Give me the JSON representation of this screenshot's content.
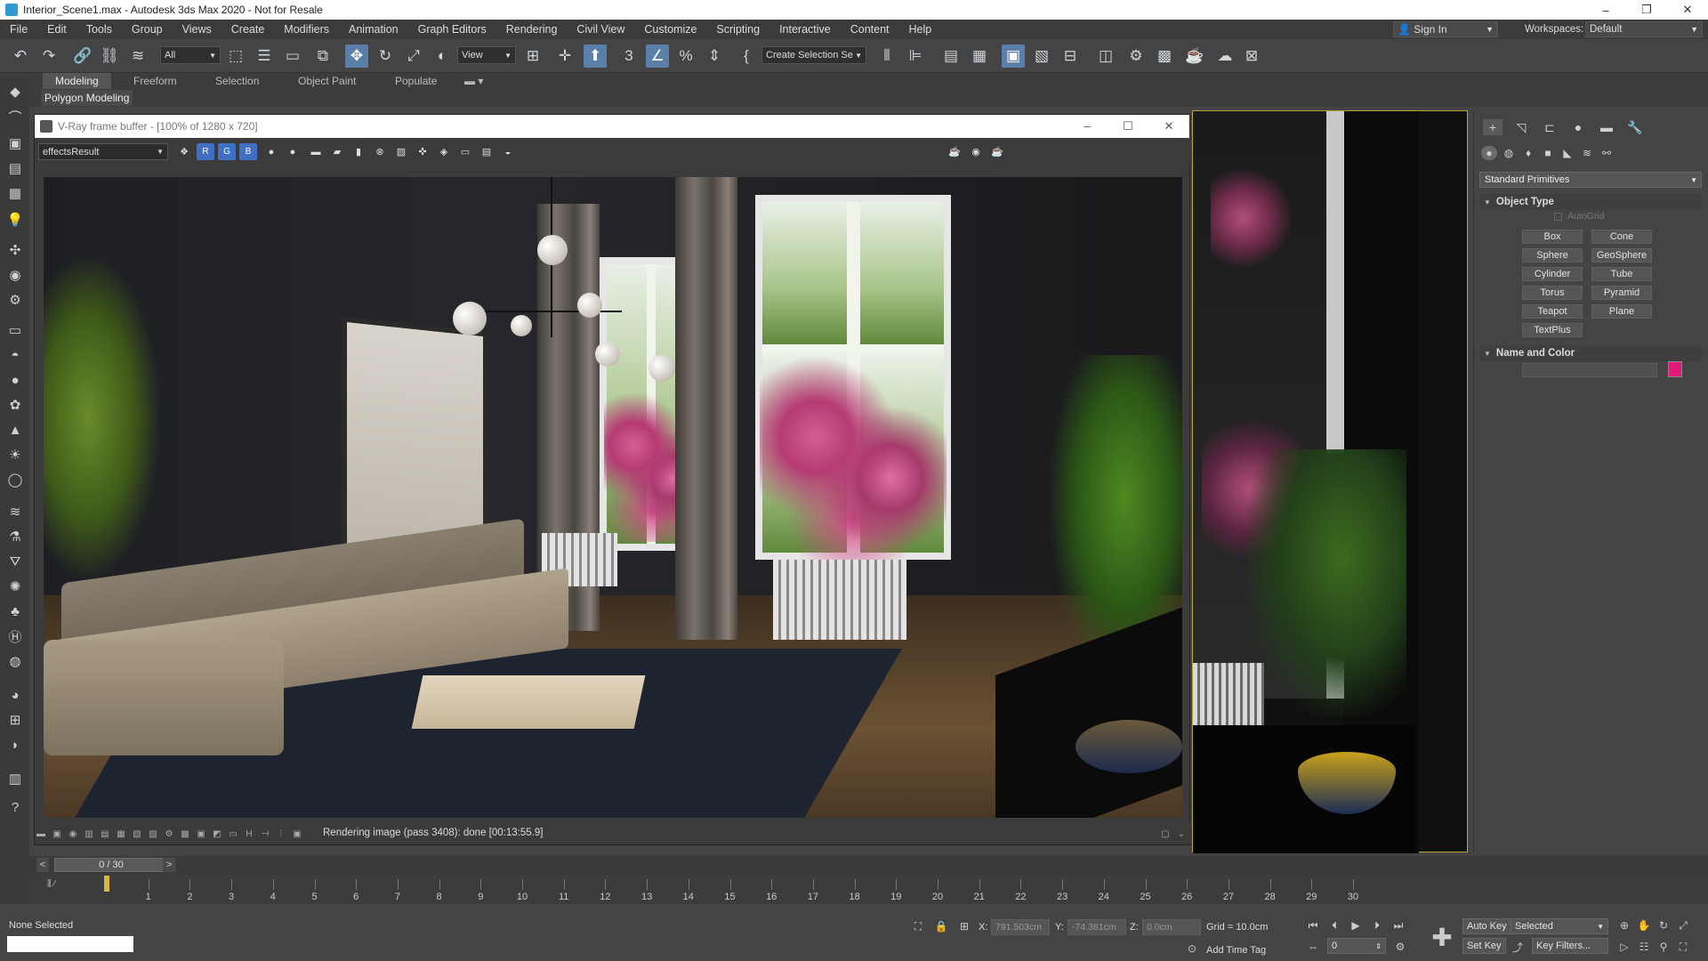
{
  "window": {
    "title": "Interior_Scene1.max - Autodesk 3ds Max 2020 - Not for Resale",
    "controls": [
      "–",
      "❐",
      "✕"
    ]
  },
  "menu": [
    "File",
    "Edit",
    "Tools",
    "Group",
    "Views",
    "Create",
    "Modifiers",
    "Animation",
    "Graph Editors",
    "Rendering",
    "Civil View",
    "Customize",
    "Scripting",
    "Interactive",
    "Content",
    "Help"
  ],
  "account": {
    "sign_in": "Sign In",
    "workspaces_label": "Workspaces:",
    "workspace": "Default"
  },
  "toolbar": {
    "selection_filter": "All",
    "ref_coord": "View",
    "named_selection": "Create Selection Se"
  },
  "ribbon": {
    "tabs": [
      "Modeling",
      "Freeform",
      "Selection",
      "Object Paint",
      "Populate"
    ],
    "panel": "Polygon Modeling"
  },
  "vfb": {
    "title": "V-Ray frame buffer - [100% of 1280 x 720]",
    "channel": "effectsResult",
    "channels": [
      "R",
      "G",
      "B"
    ],
    "status": "Rendering image (pass 3408): done [00:13:55.9]"
  },
  "command_panel": {
    "category": "Standard Primitives",
    "object_type_title": "Object Type",
    "autogrid": "AutoGrid",
    "primitives": [
      "Box",
      "Cone",
      "Sphere",
      "GeoSphere",
      "Cylinder",
      "Tube",
      "Torus",
      "Pyramid",
      "Teapot",
      "Plane",
      "TextPlus"
    ],
    "name_color_title": "Name and Color",
    "object_color": "#e0197b"
  },
  "timeline": {
    "frame_display": "0 / 30",
    "ticks": [
      "1",
      "2",
      "3",
      "4",
      "5",
      "6",
      "7",
      "8",
      "9",
      "10",
      "11",
      "12",
      "13",
      "14",
      "15",
      "16",
      "17",
      "18",
      "19",
      "20",
      "21",
      "22",
      "23",
      "24",
      "25",
      "26",
      "27",
      "28",
      "29",
      "30"
    ]
  },
  "status": {
    "selection": "None Selected",
    "x_label": "X:",
    "x_value": "791.503cm",
    "y_label": "Y:",
    "y_value": "-74.381cm",
    "z_label": "Z:",
    "z_value": "0.0cm",
    "grid": "Grid = 10.0cm",
    "add_time_tag": "Add Time Tag",
    "auto_key": "Auto Key",
    "set_key": "Set Key",
    "key_mode": "Selected",
    "key_filters": "Key Filters...",
    "current_frame": "0"
  }
}
